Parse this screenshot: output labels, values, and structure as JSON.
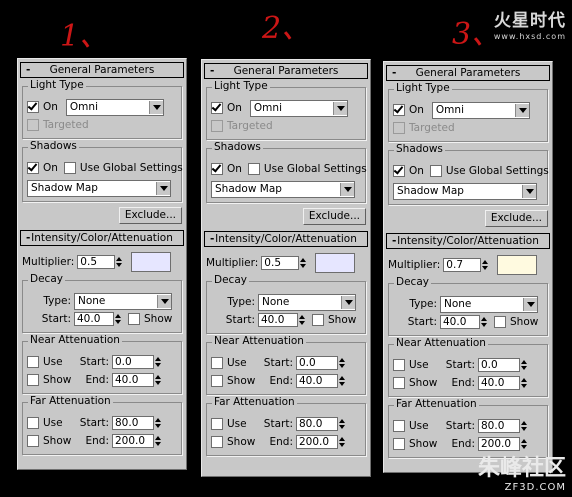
{
  "annotations": [
    "1、",
    "2、",
    "3、"
  ],
  "site_logo": {
    "name": "火星时代",
    "url": "www.hxsd.com"
  },
  "watermark": {
    "name": "朱峰社区",
    "domain": "ZF3D.COM"
  },
  "panels": [
    {
      "general_title": "General Parameters",
      "light_type_label": "Light Type",
      "on_label": "On",
      "light_type_value": "Omni",
      "targeted_label": "Targeted",
      "shadows_label": "Shadows",
      "shadows_on_label": "On",
      "use_global_label": "Use Global Settings",
      "shadow_type_value": "Shadow Map",
      "exclude_label": "Exclude...",
      "intensity_title": "Intensity/Color/Attenuation",
      "multiplier_label": "Multiplier:",
      "multiplier_value": "0.5",
      "color": "#e6e6ff",
      "decay_label": "Decay",
      "type_label": "Type:",
      "decay_type_value": "None",
      "start_label": "Start:",
      "decay_start_value": "40.0",
      "show_label": "Show",
      "near_label": "Near Attenuation",
      "use_label": "Use",
      "near_start_label": "Start:",
      "near_start_value": "0.0",
      "near_show_label": "Show",
      "end_label": "End:",
      "near_end_value": "40.0",
      "far_label": "Far Attenuation",
      "far_use_label": "Use",
      "far_start_label": "Start:",
      "far_start_value": "80.0",
      "far_show_label": "Show",
      "far_end_label": "End:",
      "far_end_value": "200.0"
    },
    {
      "general_title": "General Parameters",
      "light_type_label": "Light Type",
      "on_label": "On",
      "light_type_value": "Omni",
      "targeted_label": "Targeted",
      "shadows_label": "Shadows",
      "shadows_on_label": "On",
      "use_global_label": "Use Global Settings",
      "shadow_type_value": "Shadow Map",
      "exclude_label": "Exclude...",
      "intensity_title": "Intensity/Color/Attenuation",
      "multiplier_label": "Multiplier:",
      "multiplier_value": "0.5",
      "color": "#e6e6ff",
      "decay_label": "Decay",
      "type_label": "Type:",
      "decay_type_value": "None",
      "start_label": "Start:",
      "decay_start_value": "40.0",
      "show_label": "Show",
      "near_label": "Near Attenuation",
      "use_label": "Use",
      "near_start_label": "Start:",
      "near_start_value": "0.0",
      "near_show_label": "Show",
      "end_label": "End:",
      "near_end_value": "40.0",
      "far_label": "Far Attenuation",
      "far_use_label": "Use",
      "far_start_label": "Start:",
      "far_start_value": "80.0",
      "far_show_label": "Show",
      "far_end_label": "End:",
      "far_end_value": "200.0"
    },
    {
      "general_title": "General Parameters",
      "light_type_label": "Light Type",
      "on_label": "On",
      "light_type_value": "Omni",
      "targeted_label": "Targeted",
      "shadows_label": "Shadows",
      "shadows_on_label": "On",
      "use_global_label": "Use Global Settings",
      "shadow_type_value": "Shadow Map",
      "exclude_label": "Exclude...",
      "intensity_title": "Intensity/Color/Attenuation",
      "multiplier_label": "Multiplier:",
      "multiplier_value": "0.7",
      "color": "#fffae0",
      "decay_label": "Decay",
      "type_label": "Type:",
      "decay_type_value": "None",
      "start_label": "Start:",
      "decay_start_value": "40.0",
      "show_label": "Show",
      "near_label": "Near Attenuation",
      "use_label": "Use",
      "near_start_label": "Start:",
      "near_start_value": "0.0",
      "near_show_label": "Show",
      "end_label": "End:",
      "near_end_value": "40.0",
      "far_label": "Far Attenuation",
      "far_use_label": "Use",
      "far_start_label": "Start:",
      "far_start_value": "80.0",
      "far_show_label": "Show",
      "far_end_label": "End:",
      "far_end_value": "200.0"
    }
  ]
}
